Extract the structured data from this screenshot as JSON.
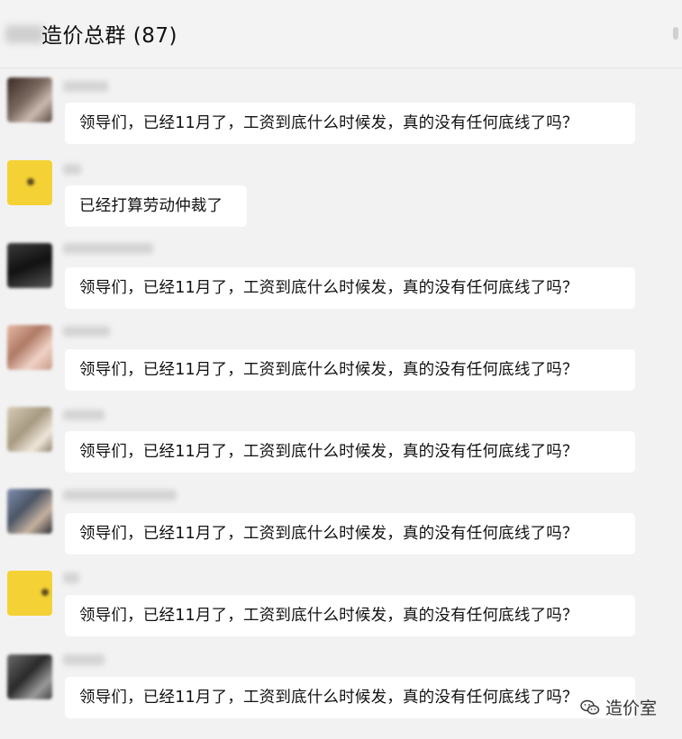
{
  "header": {
    "group_title": "造价总群 (87)"
  },
  "messages": [
    {
      "avatar": "avatar-person",
      "text": "领导们，已经11月了，工资到底什么时候发，真的没有任何底线了吗？"
    },
    {
      "avatar": "avatar-yellow",
      "text": "已经打算劳动仲裁了"
    },
    {
      "avatar": "avatar-person",
      "text": "领导们，已经11月了，工资到底什么时候发，真的没有任何底线了吗？"
    },
    {
      "avatar": "avatar-person",
      "text": "领导们，已经11月了，工资到底什么时候发，真的没有任何底线了吗？"
    },
    {
      "avatar": "avatar-person",
      "text": "领导们，已经11月了，工资到底什么时候发，真的没有任何底线了吗？"
    },
    {
      "avatar": "avatar-person",
      "text": "领导们，已经11月了，工资到底什么时候发，真的没有任何底线了吗？"
    },
    {
      "avatar": "avatar-yellow",
      "text": "领导们，已经11月了，工资到底什么时候发，真的没有任何底线了吗？"
    },
    {
      "avatar": "avatar-person",
      "text": "领导们，已经11月了，工资到底什么时候发，真的没有任何底线了吗？"
    }
  ],
  "watermark": {
    "icon": "wechat-icon",
    "text": "造价室"
  },
  "colors": {
    "background": "#f2f2f2",
    "bubble": "#ffffff",
    "yellow_avatar": "#f4d235"
  }
}
